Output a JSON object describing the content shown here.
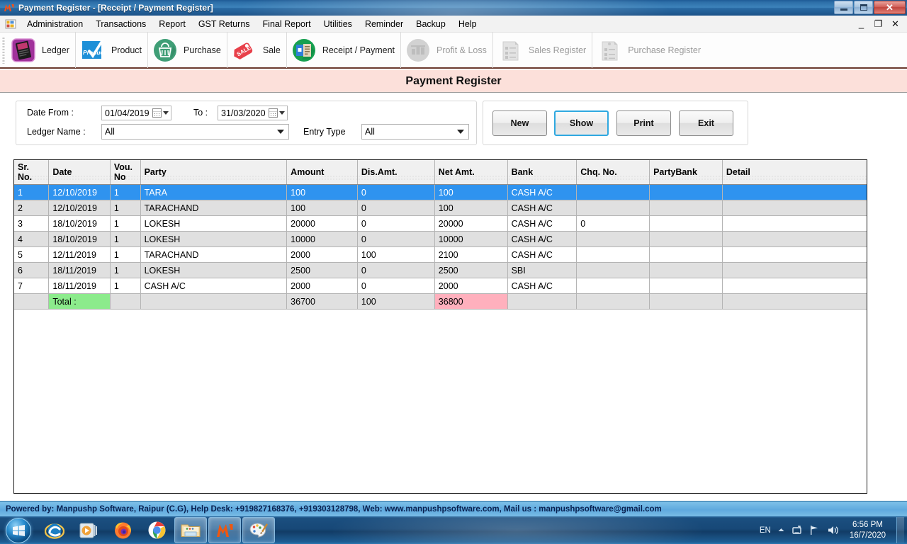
{
  "window": {
    "title": "Payment Register - [Receipt / Payment Register]",
    "minimize": "–",
    "maximize": "❐",
    "close": "✕"
  },
  "mdi_buttons": {
    "minimize": "_",
    "restore": "❐",
    "close": "✕"
  },
  "menu": {
    "items": [
      {
        "label": "Administration"
      },
      {
        "label": "Transactions"
      },
      {
        "label": "Report"
      },
      {
        "label": "GST Returns"
      },
      {
        "label": "Final Report"
      },
      {
        "label": "Utilities"
      },
      {
        "label": "Reminder"
      },
      {
        "label": "Backup"
      },
      {
        "label": "Help"
      }
    ]
  },
  "toolbar": {
    "items": [
      {
        "label": "Ledger",
        "icon": "ledger-book-icon",
        "disabled": false
      },
      {
        "label": "Product",
        "icon": "products-check-icon",
        "disabled": false
      },
      {
        "label": "Purchase",
        "icon": "basket-icon",
        "disabled": false
      },
      {
        "label": "Sale",
        "icon": "sale-tag-icon",
        "disabled": false
      },
      {
        "label": "Receipt / Payment",
        "icon": "receipt-payment-icon",
        "disabled": false
      },
      {
        "label": "Profit & Loss",
        "icon": "profit-loss-icon",
        "disabled": true
      },
      {
        "label": "Sales Register",
        "icon": "sales-register-icon",
        "disabled": true
      },
      {
        "label": "Purchase Register",
        "icon": "purchase-register-icon",
        "disabled": true
      }
    ]
  },
  "page": {
    "title": "Payment Register"
  },
  "filters": {
    "date_from_label": "Date From :",
    "date_from_value": "01/04/2019",
    "to_label": "To :",
    "to_value": "31/03/2020",
    "ledger_name_label": "Ledger Name :",
    "ledger_name_value": "All",
    "entry_type_label": "Entry Type",
    "entry_type_value": "All"
  },
  "actions": {
    "new": "New",
    "show": "Show",
    "print": "Print",
    "exit": "Exit"
  },
  "grid": {
    "columns": [
      "Sr.\nNo.",
      "Date",
      "Vou.\nNo",
      "Party",
      "Amount",
      "Dis.Amt.",
      "Net Amt.",
      "Bank",
      "Chq. No.",
      "PartyBank",
      "Detail"
    ],
    "columns_flat": [
      "Sr. No.",
      "Date",
      "Vou. No",
      "Party",
      "Amount",
      "Dis.Amt.",
      "Net Amt.",
      "Bank",
      "Chq. No.",
      "PartyBank",
      "Detail"
    ],
    "rows": [
      {
        "sr": "1",
        "date": "12/10/2019",
        "vou": "1",
        "party": "TARA",
        "amount": "100",
        "dis": "0",
        "net": "100",
        "bank": "CASH A/C",
        "chq": "",
        "partybank": "",
        "detail": "",
        "selected": true
      },
      {
        "sr": "2",
        "date": "12/10/2019",
        "vou": "1",
        "party": "TARACHAND",
        "amount": "100",
        "dis": "0",
        "net": "100",
        "bank": "CASH A/C",
        "chq": "",
        "partybank": "",
        "detail": "",
        "selected": false
      },
      {
        "sr": "3",
        "date": "18/10/2019",
        "vou": "1",
        "party": "LOKESH",
        "amount": "20000",
        "dis": "0",
        "net": "20000",
        "bank": "CASH A/C",
        "chq": "0",
        "partybank": "",
        "detail": "",
        "selected": false
      },
      {
        "sr": "4",
        "date": "18/10/2019",
        "vou": "1",
        "party": "LOKESH",
        "amount": "10000",
        "dis": "0",
        "net": "10000",
        "bank": "CASH A/C",
        "chq": "",
        "partybank": "",
        "detail": "",
        "selected": false
      },
      {
        "sr": "5",
        "date": "12/11/2019",
        "vou": "1",
        "party": "TARACHAND",
        "amount": "2000",
        "dis": "100",
        "net": "2100",
        "bank": "CASH A/C",
        "chq": "",
        "partybank": "",
        "detail": "",
        "selected": false
      },
      {
        "sr": "6",
        "date": "18/11/2019",
        "vou": "1",
        "party": "LOKESH",
        "amount": "2500",
        "dis": "0",
        "net": "2500",
        "bank": "SBI",
        "chq": "",
        "partybank": "",
        "detail": "",
        "selected": false
      },
      {
        "sr": "7",
        "date": "18/11/2019",
        "vou": "1",
        "party": "CASH A/C",
        "amount": "2000",
        "dis": "0",
        "net": "2000",
        "bank": "CASH A/C",
        "chq": "",
        "partybank": "",
        "detail": "",
        "selected": false
      }
    ],
    "total": {
      "label": "Total :",
      "amount": "36700",
      "dis": "100",
      "net": "36800"
    }
  },
  "footer": {
    "text": "Powered by: Manpushp Software, Raipur (C.G), Help Desk: +919827168376, +919303128798, Web: www.manpushpsoftware.com,  Mail us :  manpushpsoftware@gmail.com"
  },
  "taskbar": {
    "start": "start-orb-icon",
    "items": [
      {
        "icon": "internet-explorer-icon",
        "open": false
      },
      {
        "icon": "media-player-icon",
        "open": false
      },
      {
        "icon": "firefox-icon",
        "open": false
      },
      {
        "icon": "chrome-icon",
        "open": false
      },
      {
        "icon": "file-explorer-icon",
        "open": true
      },
      {
        "icon": "manpushp-app-icon",
        "open": true
      },
      {
        "icon": "paint-icon",
        "open": true
      }
    ],
    "tray": {
      "language": "EN",
      "show_hidden": "show-hidden-icons-icon",
      "action_center": "action-center-icon",
      "network": "network-icon",
      "volume": "volume-icon",
      "time": "6:56 PM",
      "date": "16/7/2020"
    }
  },
  "colors": {
    "title_band": "#fce0da",
    "selection": "#2f93ef",
    "total_label": "#8ceb8c",
    "total_net": "#ffb0bd",
    "footer": "#5fa9de",
    "accent_focus": "#2fa8e0"
  }
}
